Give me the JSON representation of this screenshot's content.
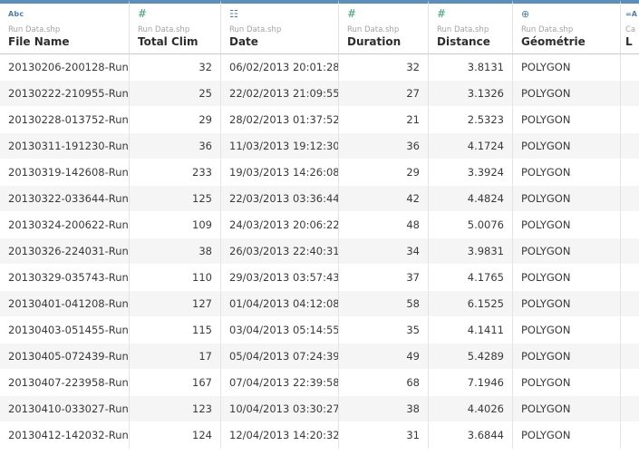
{
  "columns": [
    {
      "icon_text": "Abc",
      "icon": "string-type-icon",
      "source": "Run Data.shp",
      "name": "File Name",
      "align": "left"
    },
    {
      "icon_text": "#",
      "icon": "number-type-icon",
      "source": "Run Data.shp",
      "name": "Total Clim",
      "align": "right"
    },
    {
      "icon_text": "☷",
      "icon": "datetime-type-icon",
      "source": "Run Data.shp",
      "name": "Date",
      "align": "left"
    },
    {
      "icon_text": "#",
      "icon": "number-type-icon",
      "source": "Run Data.shp",
      "name": "Duration",
      "align": "right"
    },
    {
      "icon_text": "#",
      "icon": "number-type-icon",
      "source": "Run Data.shp",
      "name": "Distance",
      "align": "right"
    },
    {
      "icon_text": "⊕",
      "icon": "geography-type-icon",
      "source": "Run Data.shp",
      "name": "Géométrie",
      "align": "left"
    },
    {
      "icon_text": "=A",
      "icon": "calculated-string-type-icon",
      "source": "Ca",
      "name": "L",
      "align": "left"
    }
  ],
  "rows": [
    [
      "20130206-200128-Run",
      "32",
      "06/02/2013 20:01:28",
      "32",
      "3.8131",
      "POLYGON"
    ],
    [
      "20130222-210955-Run",
      "25",
      "22/02/2013 21:09:55",
      "27",
      "3.1326",
      "POLYGON"
    ],
    [
      "20130228-013752-Run",
      "29",
      "28/02/2013 01:37:52",
      "21",
      "2.5323",
      "POLYGON"
    ],
    [
      "20130311-191230-Run",
      "36",
      "11/03/2013 19:12:30",
      "36",
      "4.1724",
      "POLYGON"
    ],
    [
      "20130319-142608-Run",
      "233",
      "19/03/2013 14:26:08",
      "29",
      "3.3924",
      "POLYGON"
    ],
    [
      "20130322-033644-Run",
      "125",
      "22/03/2013 03:36:44",
      "42",
      "4.4824",
      "POLYGON"
    ],
    [
      "20130324-200622-Run",
      "109",
      "24/03/2013 20:06:22",
      "48",
      "5.0076",
      "POLYGON"
    ],
    [
      "20130326-224031-Run",
      "38",
      "26/03/2013 22:40:31",
      "34",
      "3.9831",
      "POLYGON"
    ],
    [
      "20130329-035743-Run",
      "110",
      "29/03/2013 03:57:43",
      "37",
      "4.1765",
      "POLYGON"
    ],
    [
      "20130401-041208-Run",
      "127",
      "01/04/2013 04:12:08",
      "58",
      "6.1525",
      "POLYGON"
    ],
    [
      "20130403-051455-Run",
      "115",
      "03/04/2013 05:14:55",
      "35",
      "4.1411",
      "POLYGON"
    ],
    [
      "20130405-072439-Run",
      "17",
      "05/04/2013 07:24:39",
      "49",
      "5.4289",
      "POLYGON"
    ],
    [
      "20130407-223958-Run",
      "167",
      "07/04/2013 22:39:58",
      "68",
      "7.1946",
      "POLYGON"
    ],
    [
      "20130410-033027-Run",
      "123",
      "10/04/2013 03:30:27",
      "38",
      "4.4026",
      "POLYGON"
    ],
    [
      "20130412-142032-Run",
      "124",
      "12/04/2013 14:20:32",
      "31",
      "3.6844",
      "POLYGON"
    ]
  ]
}
